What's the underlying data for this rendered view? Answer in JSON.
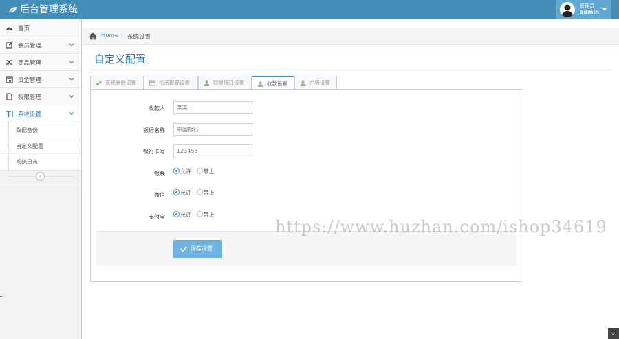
{
  "app": {
    "title": "后台管理系统"
  },
  "user": {
    "role": "管理员",
    "name": "admin"
  },
  "sidebar": {
    "items": [
      {
        "label": "首页",
        "icon": "dashboard-icon"
      },
      {
        "label": "会员管理",
        "icon": "edit-icon"
      },
      {
        "label": "商品管理",
        "icon": "random-icon"
      },
      {
        "label": "资金管理",
        "icon": "calendar-icon"
      },
      {
        "label": "权限管理",
        "icon": "file-icon"
      },
      {
        "label": "系统设置",
        "icon": "text-height-icon"
      }
    ],
    "subitems": [
      {
        "label": "数据备份"
      },
      {
        "label": "自定义配置"
      },
      {
        "label": "系统日志"
      }
    ],
    "collapse_glyph": "«"
  },
  "breadcrumb": {
    "home": "Home",
    "separator": "›",
    "current": "系统设置"
  },
  "page": {
    "title": "自定义配置"
  },
  "tabs": [
    {
      "label": "系统参数设置",
      "icon": "cogs-icon"
    },
    {
      "label": "仿币提现设置",
      "icon": "credit-card-icon"
    },
    {
      "label": "短信接口设置",
      "icon": "user-icon"
    },
    {
      "label": "收款设置",
      "icon": "user-icon",
      "active": true
    },
    {
      "label": "广告设置",
      "icon": "user-icon"
    }
  ],
  "form": {
    "payee": {
      "label": "收款人",
      "placeholder": "某某"
    },
    "bank_name": {
      "label": "银行名称",
      "placeholder": "中国银行"
    },
    "bank_card": {
      "label": "银行卡号",
      "placeholder": "123456"
    },
    "unionpay": {
      "label": "银联",
      "options": [
        "允许",
        "禁止"
      ],
      "selected": "允许"
    },
    "wechat": {
      "label": "微信",
      "options": [
        "允许",
        "禁止"
      ],
      "selected": "允许"
    },
    "alipay": {
      "label": "支付宝",
      "options": [
        "允许",
        "禁止"
      ],
      "selected": "允许"
    },
    "save_label": "保存设置"
  },
  "watermark": "https://www.huzhan.com/ishop34619",
  "scroll_top_glyph": "»",
  "colors": {
    "navbar": "#438eb9",
    "accent": "#2679b5",
    "button": "#6fb3e0"
  }
}
